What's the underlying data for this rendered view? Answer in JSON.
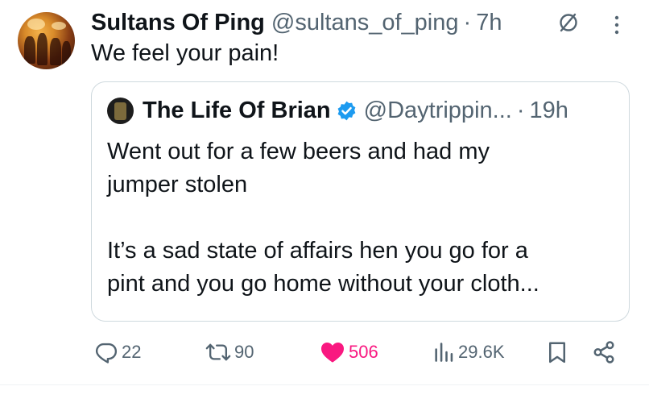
{
  "tweet": {
    "author_name": "Sultans Of Ping",
    "author_handle": "@sultans_of_ping",
    "separator": "·",
    "time": "7h",
    "text": "We feel your pain!",
    "avatar_icon": "avatar-photo"
  },
  "quoted_tweet": {
    "author_name": "The Life Of Brian",
    "verified": true,
    "verified_color": "#1d9bf0",
    "author_handle": "@Daytrippin...",
    "separator": "·",
    "time": "19h",
    "text_line1": "Went out for a few beers and had my",
    "text_line2": "jumper stolen",
    "text_line3": "It’s a sad state of affairs hen you go for a",
    "text_line4": "pint and you go home without your cloth..."
  },
  "actions": {
    "replies": "22",
    "reposts": "90",
    "likes": "506",
    "views": "29.6K",
    "like_color": "#f91880",
    "icons": [
      "reply-icon",
      "repost-icon",
      "like-icon",
      "views-icon",
      "bookmark-icon",
      "share-icon"
    ]
  },
  "header_icons": [
    "grok-icon",
    "more-icon"
  ]
}
